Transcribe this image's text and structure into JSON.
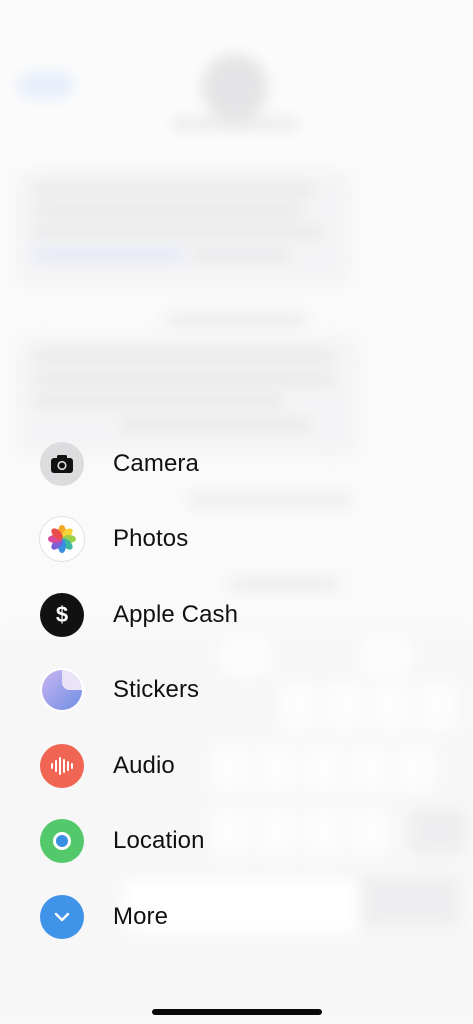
{
  "menu": {
    "items": [
      {
        "label": "Camera",
        "icon": "camera-icon"
      },
      {
        "label": "Photos",
        "icon": "photos-icon"
      },
      {
        "label": "Apple Cash",
        "icon": "apple-cash-icon"
      },
      {
        "label": "Stickers",
        "icon": "stickers-icon"
      },
      {
        "label": "Audio",
        "icon": "audio-icon"
      },
      {
        "label": "Location",
        "icon": "location-icon"
      },
      {
        "label": "More",
        "icon": "chevron-down-icon"
      }
    ]
  },
  "colors": {
    "audio": "#f06553",
    "location": "#54c96b",
    "more": "#3f93e8",
    "cash": "#111111",
    "camera_bg": "#dcdcde"
  }
}
